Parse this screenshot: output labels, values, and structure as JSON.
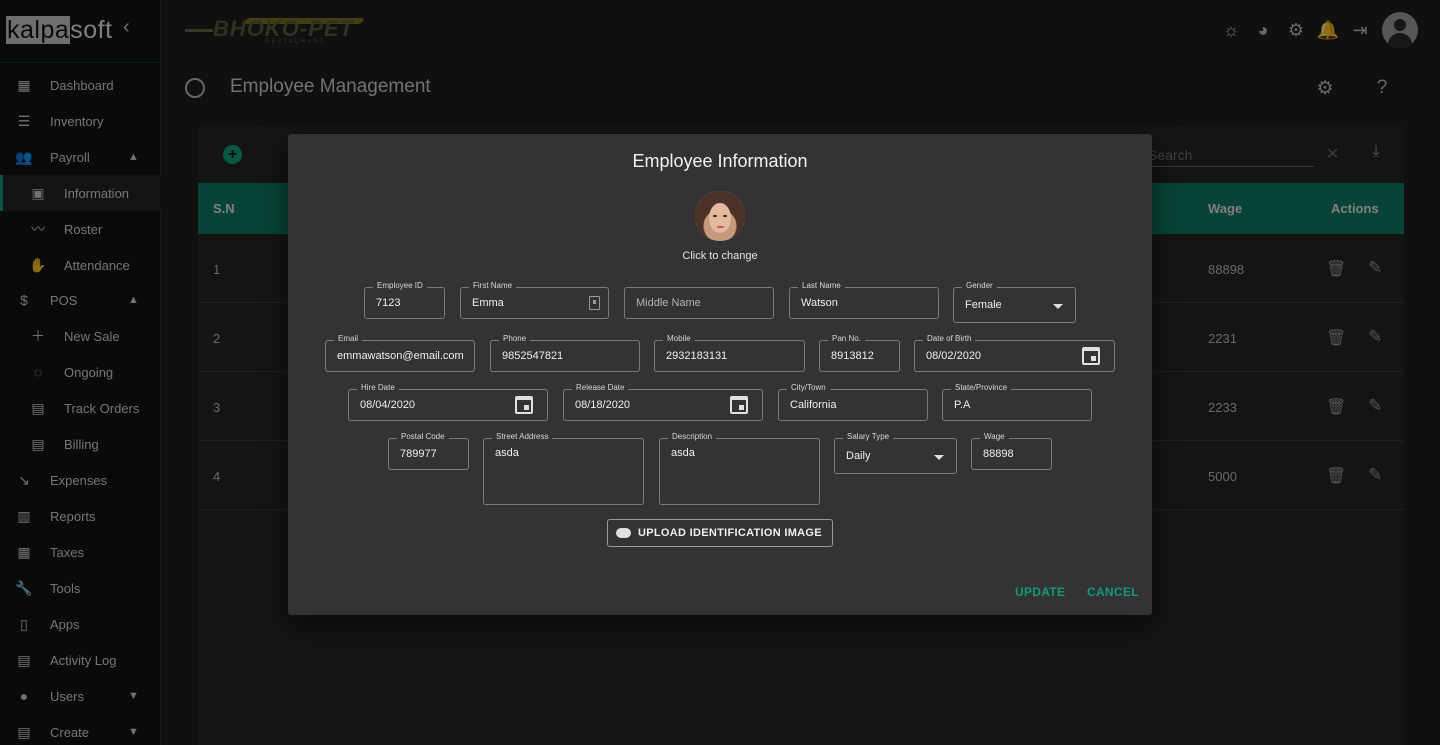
{
  "brand": {
    "name_part1": "kalpa",
    "name_part2": "soft",
    "collapse_glyph": "‹"
  },
  "sidebar": {
    "items": [
      {
        "label": "Dashboard",
        "icon": "dashboard-icon"
      },
      {
        "label": "Inventory",
        "icon": "list-icon"
      },
      {
        "label": "Payroll",
        "icon": "people-icon",
        "expanded": true
      },
      {
        "label": "Information",
        "icon": "badge-icon",
        "active": true
      },
      {
        "label": "Roster",
        "icon": "trend-icon"
      },
      {
        "label": "Attendance",
        "icon": "hand-icon"
      },
      {
        "label": "POS",
        "icon": "dollar-icon",
        "expanded": true
      },
      {
        "label": "New Sale",
        "icon": "plus-icon"
      },
      {
        "label": "Ongoing",
        "icon": "loop-icon"
      },
      {
        "label": "Track Orders",
        "icon": "calendar-grid-icon"
      },
      {
        "label": "Billing",
        "icon": "document-icon"
      },
      {
        "label": "Expenses",
        "icon": "trend-down-icon"
      },
      {
        "label": "Reports",
        "icon": "chart-icon"
      },
      {
        "label": "Taxes",
        "icon": "calculator-icon"
      },
      {
        "label": "Tools",
        "icon": "wrench-icon"
      },
      {
        "label": "Apps",
        "icon": "phone-icon"
      },
      {
        "label": "Activity Log",
        "icon": "clipboard-icon"
      },
      {
        "label": "Users",
        "icon": "user-circle-icon"
      },
      {
        "label": "Create",
        "icon": "clipboard-plus-icon"
      }
    ]
  },
  "header": {
    "logo_text": "BHOKO-PET",
    "logo_sub": "RESTAURANT",
    "icons": [
      "brightness-icon",
      "palette-icon",
      "settings-icon",
      "bell-icon",
      "exit-icon",
      "account-icon"
    ]
  },
  "page": {
    "title": "Employee Management"
  },
  "table": {
    "search_placeholder": "Search",
    "columns": {
      "sn": "S.N",
      "wage": "Wage",
      "actions": "Actions"
    },
    "rows": [
      {
        "sn": "1",
        "wage": "88898"
      },
      {
        "sn": "2",
        "wage": "2231"
      },
      {
        "sn": "3",
        "wage": "2233"
      },
      {
        "sn": "4",
        "wage": "5000"
      }
    ]
  },
  "modal": {
    "title": "Employee Information",
    "photo_caption": "Click to change",
    "fields": {
      "employee_id": {
        "label": "Employee ID",
        "value": "7123"
      },
      "first_name": {
        "label": "First Name",
        "value": "Emma"
      },
      "middle_name": {
        "placeholder": "Middle Name"
      },
      "last_name": {
        "label": "Last Name",
        "value": "Watson"
      },
      "gender": {
        "label": "Gender",
        "value": "Female"
      },
      "email": {
        "label": "Email",
        "value": "emmawatson@email.com"
      },
      "phone": {
        "label": "Phone",
        "value": "9852547821"
      },
      "mobile": {
        "label": "Mobile",
        "value": "2932183131"
      },
      "pan_no": {
        "label": "Pan No.",
        "value": "8913812"
      },
      "dob": {
        "label": "Date of Birth",
        "value": "08/02/2020"
      },
      "hire_date": {
        "label": "Hire Date",
        "value": "08/04/2020"
      },
      "release_date": {
        "label": "Release Date",
        "value": "08/18/2020"
      },
      "city": {
        "label": "City/Town",
        "value": "California"
      },
      "state": {
        "label": "State/Province",
        "value": "P.A"
      },
      "postal_code": {
        "label": "Postal Code",
        "value": "789977"
      },
      "street_address": {
        "label": "Street Address",
        "value": "asda"
      },
      "description": {
        "label": "Description",
        "value": "asda"
      },
      "salary_type": {
        "label": "Salary Type",
        "value": "Daily"
      },
      "wage": {
        "label": "Wage",
        "value": "88898"
      }
    },
    "upload_label": "UPLOAD IDENTIFICATION IMAGE",
    "update_label": "UPDATE",
    "cancel_label": "CANCEL"
  },
  "colors": {
    "accent": "#129a78",
    "table_header": "#0d7a63",
    "modal_bg": "#333333",
    "sidebar_bg": "#0f1315"
  }
}
